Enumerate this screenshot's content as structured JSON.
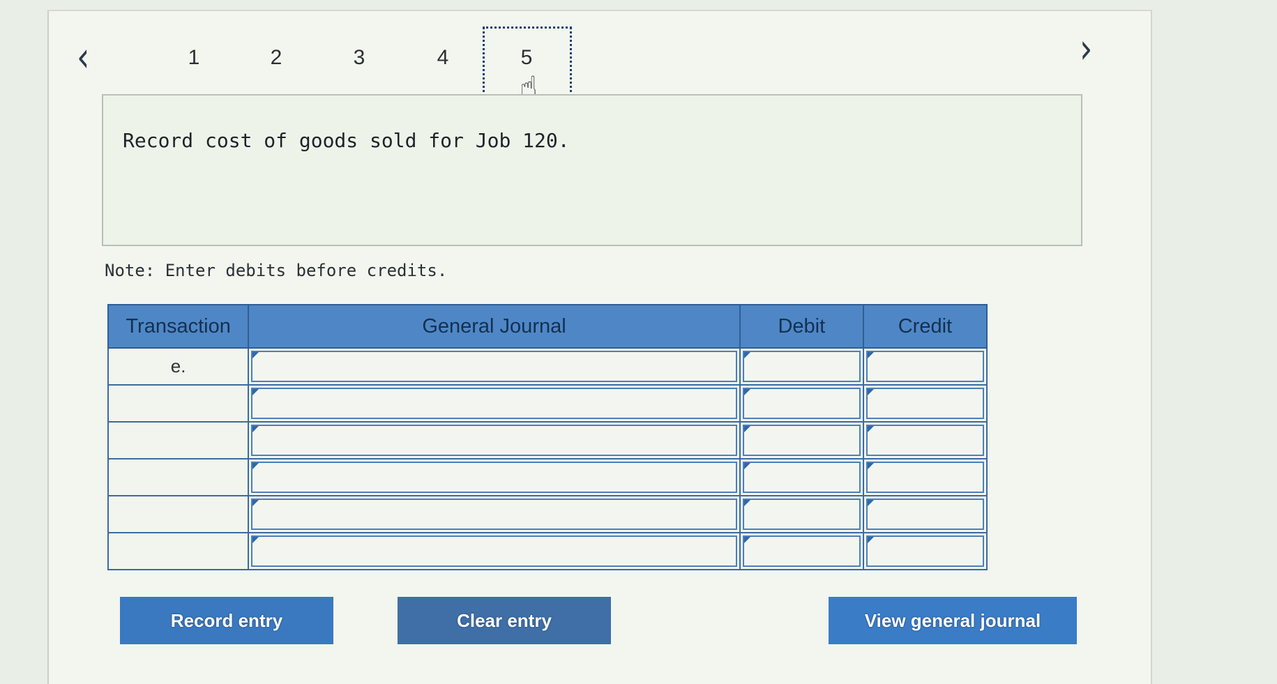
{
  "pagination": {
    "prev_icon": "chevron-left-icon",
    "next_icon": "chevron-right-icon",
    "steps": [
      "1",
      "2",
      "3",
      "4",
      "5"
    ],
    "active_step": "5"
  },
  "question": {
    "text": "Record cost of goods sold for Job 120."
  },
  "note": "Note: Enter debits before credits.",
  "journal": {
    "headers": {
      "transaction": "Transaction",
      "general_journal": "General Journal",
      "debit": "Debit",
      "credit": "Credit"
    },
    "rows": [
      {
        "transaction": "e."
      },
      {
        "transaction": ""
      },
      {
        "transaction": ""
      },
      {
        "transaction": ""
      },
      {
        "transaction": ""
      },
      {
        "transaction": ""
      }
    ]
  },
  "buttons": {
    "record": "Record entry",
    "clear": "Clear entry",
    "view": "View general journal"
  },
  "colors": {
    "header_blue": "#4f87c6",
    "button_blue": "#3a78c0"
  }
}
